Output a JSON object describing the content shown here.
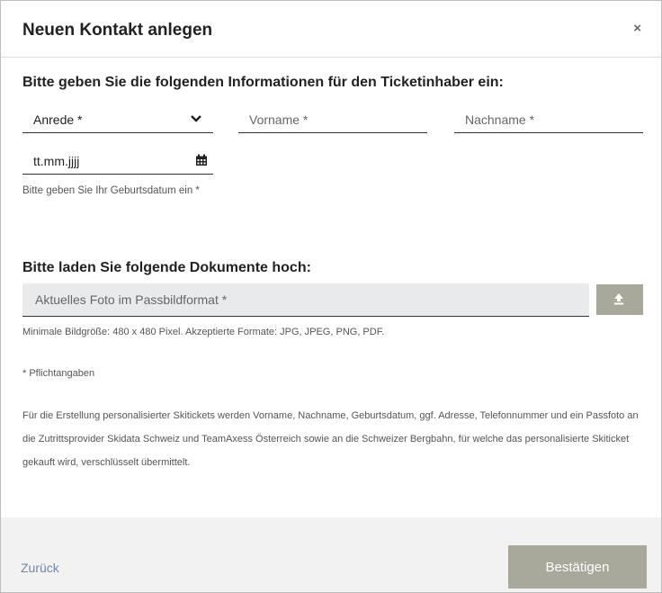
{
  "dialog": {
    "title": "Neuen Kontakt anlegen",
    "close_symbol": "×"
  },
  "ticket_holder": {
    "heading": "Bitte geben Sie die folgenden Informationen für den Ticketinhaber ein:",
    "salutation_label": "Anrede *",
    "first_name_placeholder": "Vorname *",
    "last_name_placeholder": "Nachname  *",
    "birthdate_placeholder": "tt.mm.jjjj",
    "birthdate_help": "Bitte geben Sie Ihr Geburtsdatum ein *"
  },
  "documents": {
    "heading": "Bitte laden Sie folgende Dokumente hoch:",
    "photo_placeholder": "Aktuelles Foto im Passbildformat  *",
    "upload_icon": "upload-icon",
    "requirements": "Minimale Bildgröße: 480 x 480 Pixel. Akzeptierte Formate: JPG, JPEG, PNG, PDF."
  },
  "required_note": "* Pflichtangaben",
  "privacy_info": "Für die Erstellung personalisierter Skitickets werden Vorname, Nachname, Geburtsdatum, ggf. Adresse, Telefonnummer und ein Passfoto an die Zutrittsprovider Skidata Schweiz und TeamAxess Österreich sowie an die Schweizer Bergbahn, für welche das personalisierte Skiticket gekauft wird, verschlüsselt übermittelt.",
  "footer": {
    "back_label": "Zurück",
    "confirm_label": "Bestätigen"
  },
  "colors": {
    "accent_button": "#a9a99b",
    "link": "#6a8ab2"
  }
}
